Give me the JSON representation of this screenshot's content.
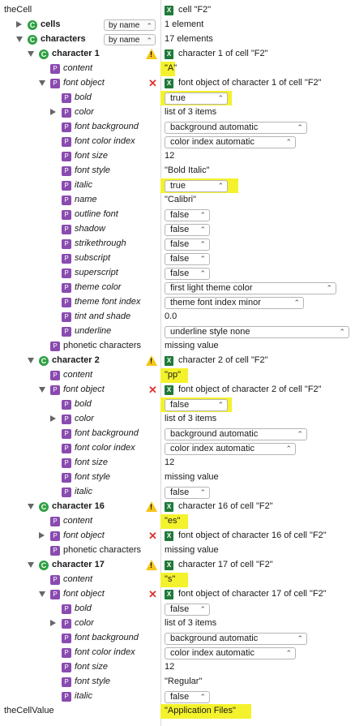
{
  "rows": [
    {
      "label": "theCell",
      "indent": 5,
      "icon": null,
      "value": "cell \"F2\"",
      "value_type": "excel"
    },
    {
      "label": "cells",
      "indent": 34,
      "icon": "C",
      "disc": "closed",
      "bold": true,
      "pop": "by name",
      "value": "1 element",
      "value_type": "text"
    },
    {
      "label": "characters",
      "indent": 34,
      "icon": "C",
      "disc": "open",
      "bold": true,
      "pop": "by name",
      "value": "17 elements",
      "value_type": "text"
    },
    {
      "label": "character 1",
      "indent": 48,
      "icon": "C",
      "disc": "open",
      "bold": true,
      "warn": true,
      "value": "character 1 of cell \"F2\"",
      "value_type": "excel"
    },
    {
      "label": "content",
      "indent": 62,
      "icon": "P",
      "it": true,
      "value": "\"A\"",
      "value_type": "text",
      "hl": [
        198,
        216
      ]
    },
    {
      "label": "font object",
      "indent": 62,
      "icon": "P",
      "disc": "open",
      "it": true,
      "xmark": true,
      "value": "font object of character 1 of cell \"F2\"",
      "value_type": "excel"
    },
    {
      "label": "bold",
      "indent": 76,
      "icon": "P",
      "it": true,
      "value": "true",
      "value_type": "dd",
      "ddw": 78,
      "hl": [
        198,
        286
      ]
    },
    {
      "label": "color",
      "indent": 76,
      "icon": "P",
      "disc": "closed",
      "it": true,
      "value": "list of 3 items",
      "value_type": "text"
    },
    {
      "label": "font background",
      "indent": 76,
      "icon": "P",
      "it": true,
      "value": "background automatic",
      "value_type": "dd",
      "ddw": 176
    },
    {
      "label": "font color index",
      "indent": 76,
      "icon": "P",
      "it": true,
      "value": "color index automatic",
      "value_type": "dd",
      "ddw": 162
    },
    {
      "label": "font size",
      "indent": 76,
      "icon": "P",
      "it": true,
      "value": "12",
      "value_type": "text"
    },
    {
      "label": "font style",
      "indent": 76,
      "icon": "P",
      "it": true,
      "value": "\"Bold Italic\"",
      "value_type": "text"
    },
    {
      "label": "italic",
      "indent": 76,
      "icon": "P",
      "it": true,
      "value": "true",
      "value_type": "dd",
      "ddw": 78,
      "hl": [
        198,
        294
      ]
    },
    {
      "label": "name",
      "indent": 76,
      "icon": "P",
      "it": true,
      "value": "\"Calibri\"",
      "value_type": "text"
    },
    {
      "label": "outline font",
      "indent": 76,
      "icon": "P",
      "it": true,
      "value": "false",
      "value_type": "dd",
      "ddw": 56
    },
    {
      "label": "shadow",
      "indent": 76,
      "icon": "P",
      "it": true,
      "value": "false",
      "value_type": "dd",
      "ddw": 56
    },
    {
      "label": "strikethrough",
      "indent": 76,
      "icon": "P",
      "it": true,
      "value": "false",
      "value_type": "dd",
      "ddw": 56
    },
    {
      "label": "subscript",
      "indent": 76,
      "icon": "P",
      "it": true,
      "value": "false",
      "value_type": "dd",
      "ddw": 56
    },
    {
      "label": "superscript",
      "indent": 76,
      "icon": "P",
      "it": true,
      "value": "false",
      "value_type": "dd",
      "ddw": 56
    },
    {
      "label": "theme color",
      "indent": 76,
      "icon": "P",
      "it": true,
      "value": "first light theme color",
      "value_type": "dd",
      "ddw": 212
    },
    {
      "label": "theme font index",
      "indent": 76,
      "icon": "P",
      "it": true,
      "value": "theme font index minor",
      "value_type": "dd",
      "ddw": 172
    },
    {
      "label": "tint and shade",
      "indent": 76,
      "icon": "P",
      "it": true,
      "value": "0.0",
      "value_type": "text"
    },
    {
      "label": "underline",
      "indent": 76,
      "icon": "P",
      "it": true,
      "value": "underline style none",
      "value_type": "dd",
      "ddw": 228
    },
    {
      "label": "phonetic characters",
      "indent": 62,
      "icon": "P",
      "value": "missing value",
      "value_type": "text"
    },
    {
      "label": "character 2",
      "indent": 48,
      "icon": "C",
      "disc": "open",
      "bold": true,
      "warn": true,
      "value": "character 2 of cell \"F2\"",
      "value_type": "excel"
    },
    {
      "label": "content",
      "indent": 62,
      "icon": "P",
      "it": true,
      "value": "\"pp\"",
      "value_type": "text",
      "hl": [
        198,
        232
      ]
    },
    {
      "label": "font object",
      "indent": 62,
      "icon": "P",
      "disc": "open",
      "it": true,
      "xmark": true,
      "value": "font object of character 2 of cell \"F2\"",
      "value_type": "excel"
    },
    {
      "label": "bold",
      "indent": 76,
      "icon": "P",
      "it": true,
      "value": "false",
      "value_type": "dd",
      "ddw": 78,
      "hl": [
        198,
        286
      ]
    },
    {
      "label": "color",
      "indent": 76,
      "icon": "P",
      "disc": "closed",
      "it": true,
      "value": "list of 3 items",
      "value_type": "text"
    },
    {
      "label": "font background",
      "indent": 76,
      "icon": "P",
      "it": true,
      "value": "background automatic",
      "value_type": "dd",
      "ddw": 176
    },
    {
      "label": "font color index",
      "indent": 76,
      "icon": "P",
      "it": true,
      "value": "color index automatic",
      "value_type": "dd",
      "ddw": 162
    },
    {
      "label": "font size",
      "indent": 76,
      "icon": "P",
      "it": true,
      "value": "12",
      "value_type": "text"
    },
    {
      "label": "font style",
      "indent": 76,
      "icon": "P",
      "it": true,
      "value": "missing value",
      "value_type": "text"
    },
    {
      "label": "italic",
      "indent": 76,
      "icon": "P",
      "it": true,
      "value": "false",
      "value_type": "dd",
      "ddw": 56
    },
    {
      "label": "character 16",
      "indent": 48,
      "icon": "C",
      "disc": "open",
      "bold": true,
      "warn": true,
      "value": "character 16 of cell \"F2\"",
      "value_type": "excel"
    },
    {
      "label": "content",
      "indent": 62,
      "icon": "P",
      "it": true,
      "value": "\"es\"",
      "value_type": "text",
      "hl": [
        198,
        232
      ]
    },
    {
      "label": "font object",
      "indent": 62,
      "icon": "P",
      "disc": "closed",
      "it": true,
      "xmark": true,
      "value": "font object of character 16 of cell \"F2\"",
      "value_type": "excel"
    },
    {
      "label": "phonetic characters",
      "indent": 62,
      "icon": "P",
      "value": "missing value",
      "value_type": "text"
    },
    {
      "label": "character 17",
      "indent": 48,
      "icon": "C",
      "disc": "open",
      "bold": true,
      "warn": true,
      "value": "character 17 of cell \"F2\"",
      "value_type": "excel"
    },
    {
      "label": "content",
      "indent": 62,
      "icon": "P",
      "it": true,
      "value": "\"s\"",
      "value_type": "text",
      "hl": [
        198,
        232
      ]
    },
    {
      "label": "font object",
      "indent": 62,
      "icon": "P",
      "disc": "open",
      "it": true,
      "xmark": true,
      "value": "font object of character 17 of cell \"F2\"",
      "value_type": "excel"
    },
    {
      "label": "bold",
      "indent": 76,
      "icon": "P",
      "it": true,
      "value": "false",
      "value_type": "dd",
      "ddw": 56
    },
    {
      "label": "color",
      "indent": 76,
      "icon": "P",
      "disc": "closed",
      "it": true,
      "value": "list of 3 items",
      "value_type": "text"
    },
    {
      "label": "font background",
      "indent": 76,
      "icon": "P",
      "it": true,
      "value": "background automatic",
      "value_type": "dd",
      "ddw": 176
    },
    {
      "label": "font color index",
      "indent": 76,
      "icon": "P",
      "it": true,
      "value": "color index automatic",
      "value_type": "dd",
      "ddw": 162
    },
    {
      "label": "font size",
      "indent": 76,
      "icon": "P",
      "it": true,
      "value": "12",
      "value_type": "text"
    },
    {
      "label": "font style",
      "indent": 76,
      "icon": "P",
      "it": true,
      "value": "\"Regular\"",
      "value_type": "text"
    },
    {
      "label": "italic",
      "indent": 76,
      "icon": "P",
      "it": true,
      "value": "false",
      "value_type": "dd",
      "ddw": 56
    },
    {
      "label": "theCellValue",
      "indent": 5,
      "icon": null,
      "value": "\"Application Files\"",
      "value_type": "text",
      "hl": [
        198,
        310
      ]
    }
  ],
  "colors": {
    "highlight": "#f4f22c",
    "class_icon": "#2ea043",
    "prop_icon": "#8a4bb0",
    "excel": "#1f7a3a"
  }
}
